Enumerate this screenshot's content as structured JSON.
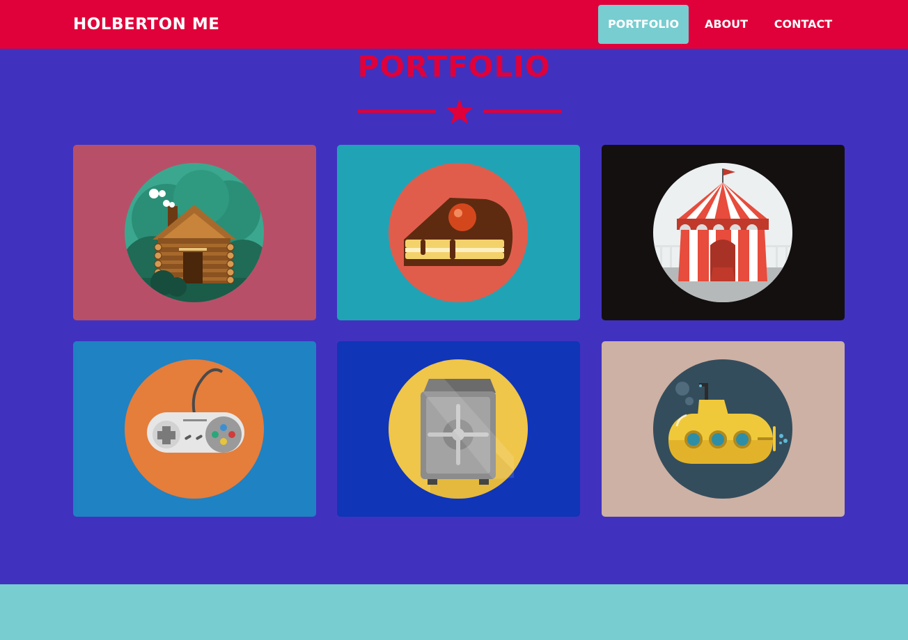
{
  "header": {
    "brand": "HOLBERTON ME",
    "nav": [
      {
        "label": "PORTFOLIO",
        "active": true
      },
      {
        "label": "ABOUT",
        "active": false
      },
      {
        "label": "CONTACT",
        "active": false
      }
    ]
  },
  "section": {
    "title": "PORTFOLIO",
    "divider_icon": "star-icon"
  },
  "colors": {
    "header_bg": "#e0003a",
    "page_bg": "#4032bf",
    "accent": "#77cdd0",
    "title": "#e0003a"
  },
  "portfolio_items": [
    {
      "icon": "cabin-icon",
      "bg": "#b84f68",
      "circle": "#3ca78f"
    },
    {
      "icon": "cake-icon",
      "bg": "#21a3b6",
      "circle": "#e05d4c"
    },
    {
      "icon": "circus-tent-icon",
      "bg": "#141010",
      "circle": "#ecf0f1"
    },
    {
      "icon": "game-controller-icon",
      "bg": "#1f82c3",
      "circle": "#e57d3b"
    },
    {
      "icon": "safe-icon",
      "bg": "#1035b7",
      "circle": "#efc54a"
    },
    {
      "icon": "submarine-icon",
      "bg": "#cdb1a4",
      "circle": "#344d5d"
    }
  ]
}
